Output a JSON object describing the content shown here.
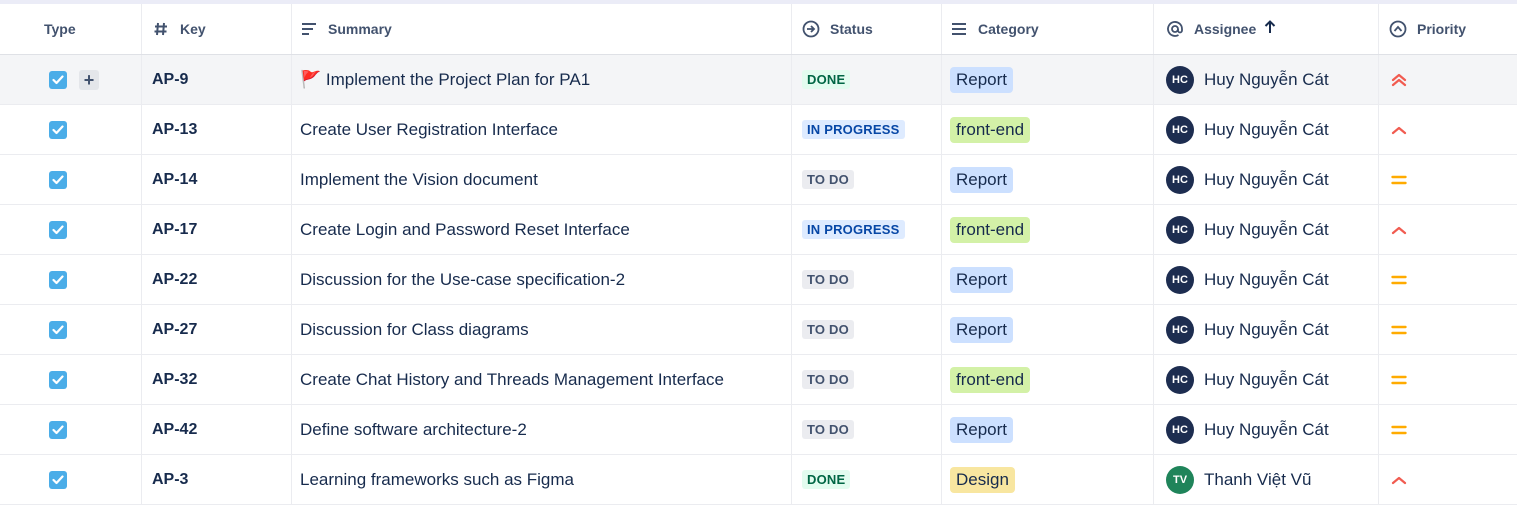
{
  "columns": {
    "type": "Type",
    "key": "Key",
    "summary": "Summary",
    "status": "Status",
    "category": "Category",
    "assignee": "Assignee",
    "priority": "Priority"
  },
  "colors": {
    "checkbox": "#4BADE8",
    "done_bg": "#E3FCEF",
    "done_text": "#006644",
    "progress_bg": "#DEEBFF",
    "progress_text": "#0747A6",
    "todo_bg": "#EBECF0",
    "todo_text": "#42526E",
    "report": "#CCE0FF",
    "frontend": "#D3F1A7",
    "design": "#F8E6A0",
    "priority_high": "#F15B50",
    "priority_medium": "#FFAB00",
    "avatar_hc": "#1D2D50",
    "avatar_tv": "#1F845A"
  },
  "rows": [
    {
      "key": "AP-9",
      "summary": "🚩 Implement the Project Plan for PA1",
      "status": "DONE",
      "status_type": "done",
      "category": "Report",
      "category_type": "report",
      "initials": "HC",
      "assignee": "Huy Nguyễn Cát",
      "priority": "highest-icon"
    },
    {
      "key": "AP-13",
      "summary": "Create User Registration Interface",
      "status": "IN PROGRESS",
      "status_type": "progress",
      "category": "front-end",
      "category_type": "frontend",
      "initials": "HC",
      "assignee": "Huy Nguyễn Cát",
      "priority": "high-icon"
    },
    {
      "key": "AP-14",
      "summary": "Implement the Vision document",
      "status": "TO DO",
      "status_type": "todo",
      "category": "Report",
      "category_type": "report",
      "initials": "HC",
      "assignee": "Huy Nguyễn Cát",
      "priority": "medium-icon"
    },
    {
      "key": "AP-17",
      "summary": "Create Login and Password Reset Interface",
      "status": "IN PROGRESS",
      "status_type": "progress",
      "category": "front-end",
      "category_type": "frontend",
      "initials": "HC",
      "assignee": "Huy Nguyễn Cát",
      "priority": "high-icon"
    },
    {
      "key": "AP-22",
      "summary": "Discussion for the Use-case specification-2",
      "status": "TO DO",
      "status_type": "todo",
      "category": "Report",
      "category_type": "report",
      "initials": "HC",
      "assignee": "Huy Nguyễn Cát",
      "priority": "medium-icon"
    },
    {
      "key": "AP-27",
      "summary": "Discussion for Class diagrams",
      "status": "TO DO",
      "status_type": "todo",
      "category": "Report",
      "category_type": "report",
      "initials": "HC",
      "assignee": "Huy Nguyễn Cát",
      "priority": "medium-icon"
    },
    {
      "key": "AP-32",
      "summary": "Create Chat History and Threads Management Interface",
      "status": "TO DO",
      "status_type": "todo",
      "category": "front-end",
      "category_type": "frontend",
      "initials": "HC",
      "assignee": "Huy Nguyễn Cát",
      "priority": "medium-icon"
    },
    {
      "key": "AP-42",
      "summary": "Define software architecture-2",
      "status": "TO DO",
      "status_type": "todo",
      "category": "Report",
      "category_type": "report",
      "initials": "HC",
      "assignee": "Huy Nguyễn Cát",
      "priority": "medium-icon"
    },
    {
      "key": "AP-3",
      "summary": "Learning frameworks such as Figma",
      "status": "DONE",
      "status_type": "done",
      "category": "Design",
      "category_type": "design",
      "initials": "TV",
      "assignee": "Thanh Việt Vũ",
      "priority": "high-icon"
    }
  ],
  "row_actions": {
    "add_label": "+"
  }
}
